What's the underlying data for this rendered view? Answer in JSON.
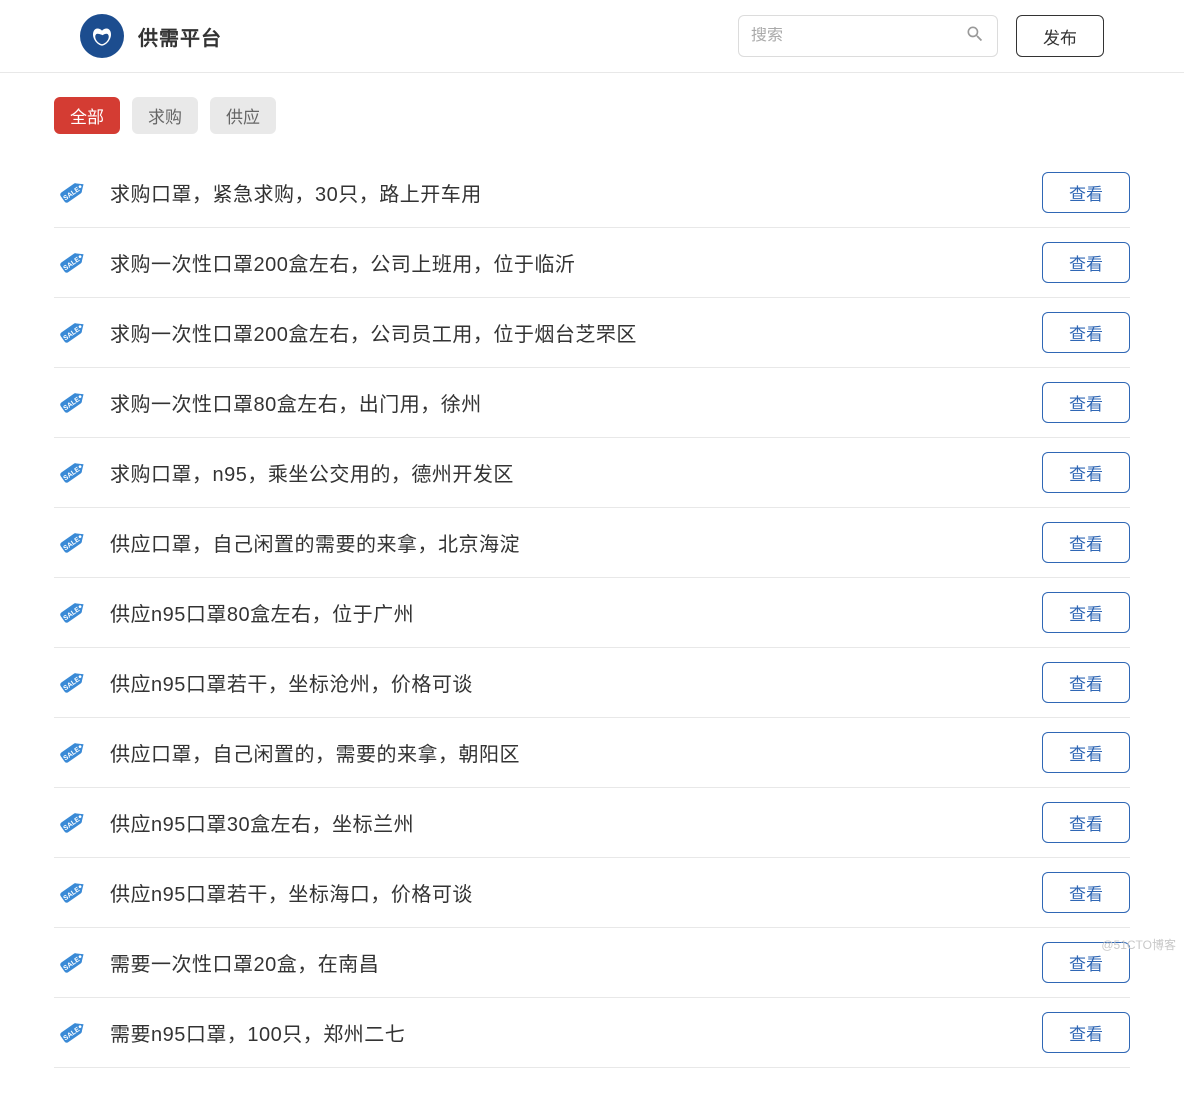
{
  "header": {
    "title": "供需平台",
    "search_placeholder": "搜索",
    "publish_label": "发布"
  },
  "tabs": {
    "all": "全部",
    "buy": "求购",
    "sell": "供应"
  },
  "view_label": "查看",
  "items": [
    {
      "title": "求购口罩，紧急求购，30只，路上开车用"
    },
    {
      "title": "求购一次性口罩200盒左右，公司上班用，位于临沂"
    },
    {
      "title": "求购一次性口罩200盒左右，公司员工用，位于烟台芝罘区"
    },
    {
      "title": "求购一次性口罩80盒左右，出门用，徐州"
    },
    {
      "title": "求购口罩，n95，乘坐公交用的，德州开发区"
    },
    {
      "title": "供应口罩，自己闲置的需要的来拿，北京海淀"
    },
    {
      "title": "供应n95口罩80盒左右，位于广州"
    },
    {
      "title": "供应n95口罩若干，坐标沧州，价格可谈"
    },
    {
      "title": "供应口罩，自己闲置的，需要的来拿，朝阳区"
    },
    {
      "title": "供应n95口罩30盒左右，坐标兰州"
    },
    {
      "title": "供应n95口罩若干，坐标海口，价格可谈"
    },
    {
      "title": "需要一次性口罩20盒，在南昌"
    },
    {
      "title": "需要n95口罩，100只，郑州二七"
    }
  ],
  "watermark": "@51CTO博客"
}
